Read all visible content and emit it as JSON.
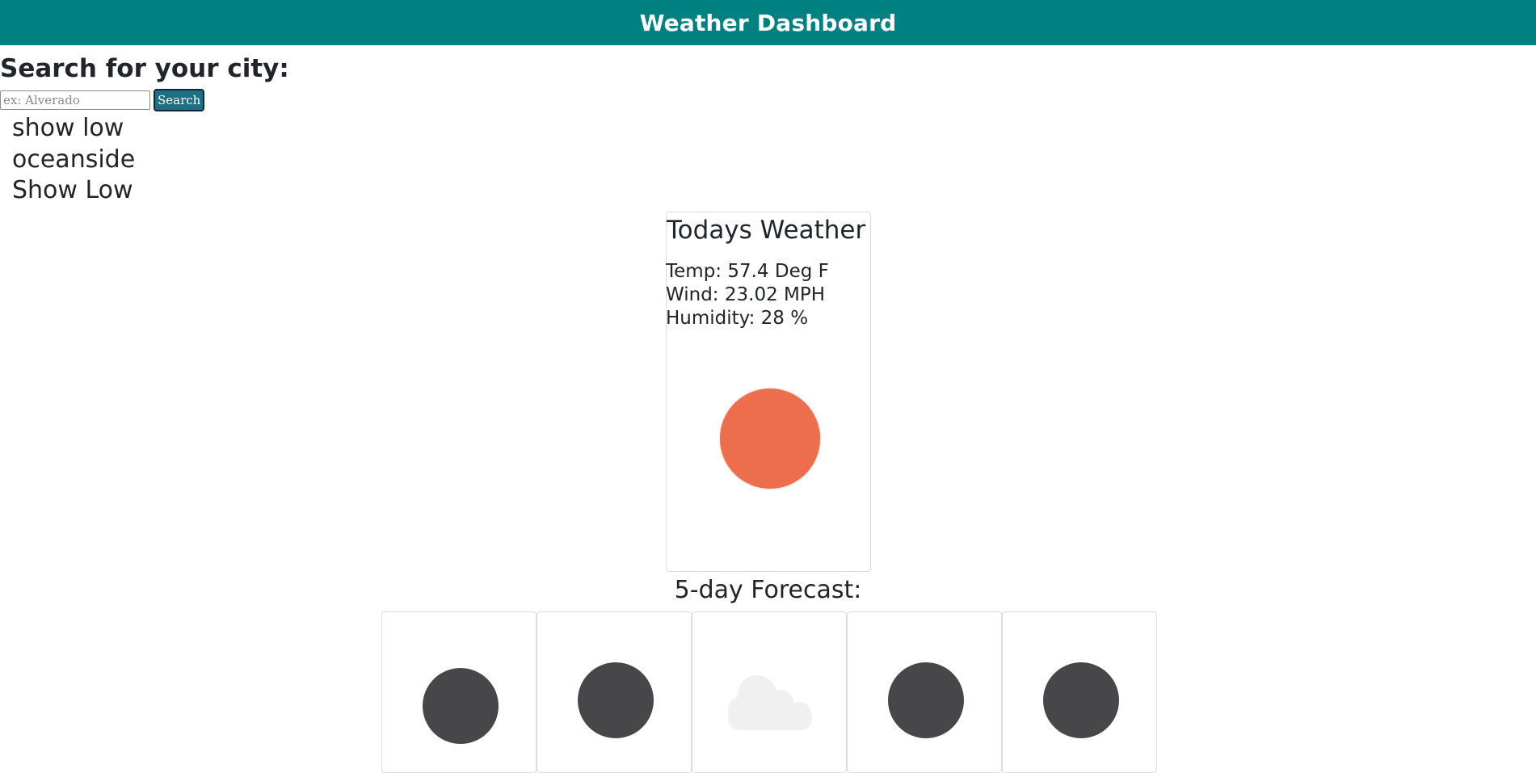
{
  "header": {
    "title": "Weather Dashboard"
  },
  "search": {
    "heading": "Search for your city:",
    "placeholder": "ex: Alverado",
    "value": "",
    "button_label": "Search"
  },
  "history": {
    "items": [
      {
        "label": "show low"
      },
      {
        "label": "oceanside"
      },
      {
        "label": "Show Low"
      }
    ]
  },
  "today": {
    "title": "Todays Weather",
    "temp": "Temp: 57.4 Deg F",
    "wind": "Wind: 23.02 MPH",
    "humidity": "Humidity: 28 %",
    "icon": "sun-icon",
    "icon_color": "#ec6e4c"
  },
  "forecast": {
    "heading": "5-day Forecast:",
    "days": [
      {
        "icon": "moon-icon"
      },
      {
        "icon": "moon-icon"
      },
      {
        "icon": "cloud-icon"
      },
      {
        "icon": "moon-icon"
      },
      {
        "icon": "moon-icon"
      }
    ]
  },
  "colors": {
    "header_bg": "#008080",
    "button_bg": "#1f6f84",
    "moon": "#474749",
    "cloud": "#f0f0f0"
  }
}
